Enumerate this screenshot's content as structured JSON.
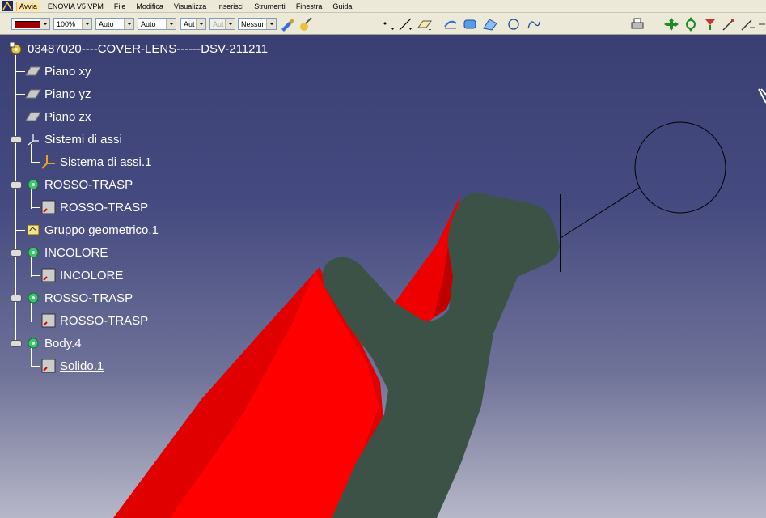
{
  "menu": [
    "Avvia",
    "ENOVIA V5 VPM",
    "File",
    "Modifica",
    "Visualizza",
    "Inserisci",
    "Strumenti",
    "Finestra",
    "Guida"
  ],
  "toolbar": {
    "color": "#a00000",
    "zoom": "100%",
    "combo_a": "Auto",
    "combo_b": "Auto",
    "combo_c": "Aut",
    "combo_d": "Aut",
    "layer": "Nessuno"
  },
  "tree": {
    "root": "03487020----COVER-LENS------DSV-211211",
    "plane_xy": "Piano xy",
    "plane_yz": "Piano yz",
    "plane_zx": "Piano zx",
    "axis_systems": "Sistemi di assi",
    "axis_system_1": "Sistema di assi.1",
    "body1": "ROSSO-TRASP",
    "body1_solid": "ROSSO-TRASP",
    "geo_set": "Gruppo geometrico.1",
    "body2": "INCOLORE",
    "body2_solid": "INCOLORE",
    "body3": "ROSSO-TRASP",
    "body3_solid": "ROSSO-TRASP",
    "body4": "Body.4",
    "body4_solid": "Solido.1"
  },
  "colors": {
    "part_red": "#ff0000",
    "part_green": "#3c5246",
    "background_top": "#3a3f73",
    "background_bottom": "#b6b7c8"
  }
}
